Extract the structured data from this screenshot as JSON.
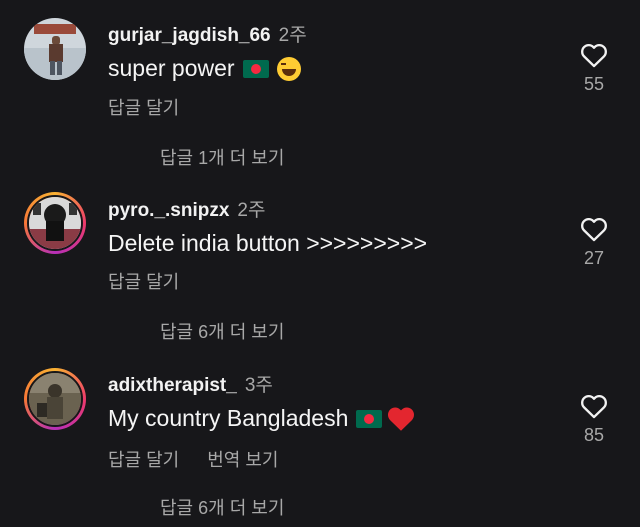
{
  "comments": [
    {
      "username": "gurjar_jagdish_66",
      "time": "2주",
      "text": "super power",
      "emoji": [
        "bangladesh-flag",
        "laughing-emoji"
      ],
      "reply_label": "답글 달기",
      "like_count": "55",
      "view_replies": "답글 1개 더 보기"
    },
    {
      "username": "pyro._.snipzx",
      "time": "2주",
      "text": "Delete india button >>>>>>>>>",
      "reply_label": "답글 달기",
      "like_count": "27",
      "view_replies": "답글 6개 더 보기"
    },
    {
      "username": "adixtherapist_",
      "time": "3주",
      "text": "My country Bangladesh",
      "emoji": [
        "bangladesh-flag",
        "red-heart-emoji"
      ],
      "reply_label": "답글 달기",
      "translate_label": "번역 보기",
      "like_count": "85",
      "view_replies": "답글 6개 더 보기"
    }
  ]
}
